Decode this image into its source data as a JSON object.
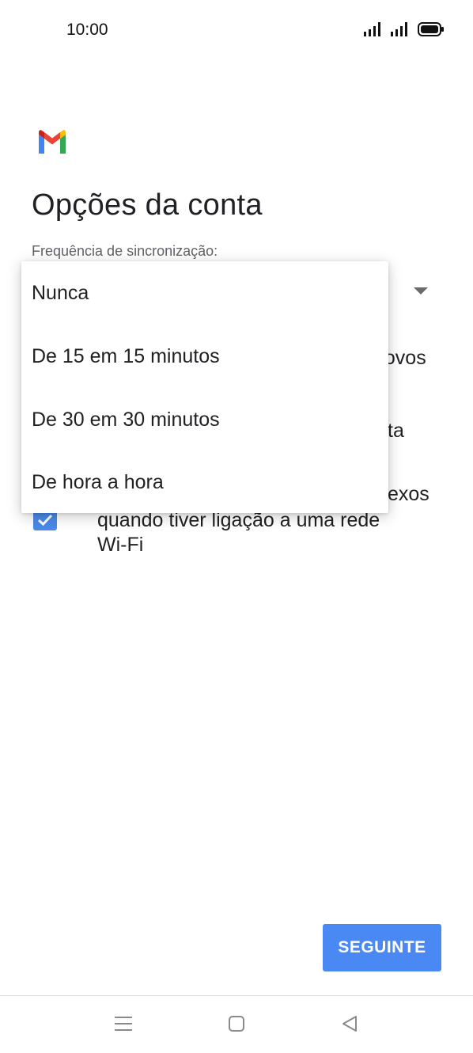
{
  "status_bar": {
    "time": "10:00",
    "icons": [
      "signal-icon",
      "signal-icon",
      "battery-icon"
    ]
  },
  "brand": {
    "logo": "gmail-logo"
  },
  "page": {
    "title": "Opções da conta",
    "sync_label": "Frequência de sincronização:"
  },
  "background_partial_text": {
    "line1_fragment": "novos",
    "line2_fragment": "ta",
    "line3_fragment": "exos",
    "checkbox_line1": "quando tiver ligação a uma rede",
    "checkbox_line2": "Wi-Fi"
  },
  "dropdown": {
    "options": [
      {
        "label": "Nunca"
      },
      {
        "label": "De 15 em 15 minutos"
      },
      {
        "label": "De 30 em 30 minutos"
      },
      {
        "label": "De hora a hora"
      }
    ]
  },
  "actions": {
    "next_label": "SEGUINTE"
  },
  "nav_bar": {
    "icons": [
      "menu-icon",
      "home-icon",
      "back-icon"
    ]
  },
  "colors": {
    "accent": "#4a89f3",
    "checkbox": "#4a89e8",
    "text": "#202124",
    "label": "#5f6368"
  }
}
